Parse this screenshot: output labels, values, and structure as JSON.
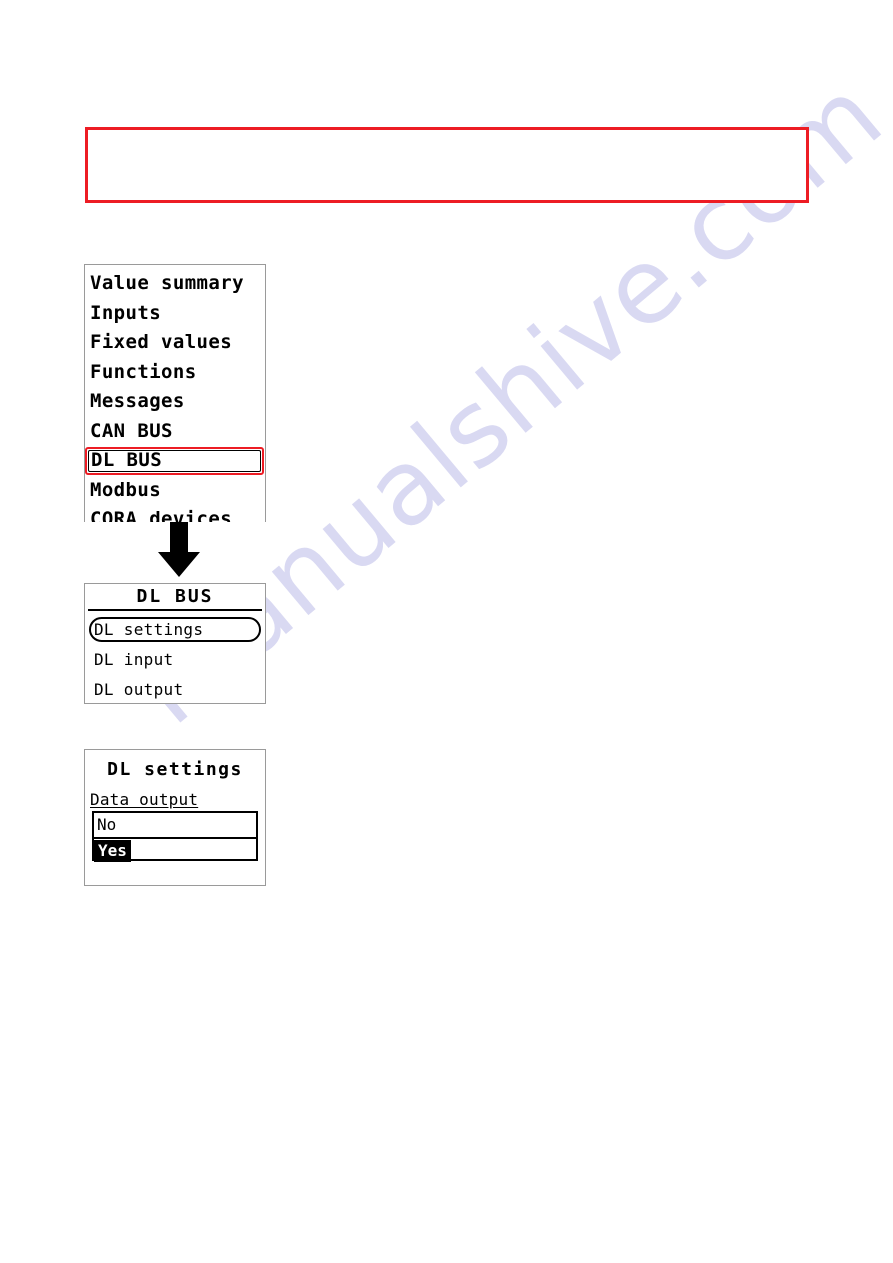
{
  "page": {
    "watermark": "manualshive.com",
    "red_note": ""
  },
  "main_menu": {
    "name": "main-menu",
    "items": [
      {
        "label": "Value summary",
        "selected": false
      },
      {
        "label": "Inputs",
        "selected": false
      },
      {
        "label": "Fixed values",
        "selected": false
      },
      {
        "label": "Functions",
        "selected": false
      },
      {
        "label": "Messages",
        "selected": false
      },
      {
        "label": "CAN BUS",
        "selected": false
      },
      {
        "label": "DL BUS",
        "selected": true
      },
      {
        "label": "Modbus",
        "selected": false
      },
      {
        "label": "CORA devices",
        "selected": false
      }
    ],
    "selection_color": "#ed1c24"
  },
  "arrow": {
    "icon": "arrow-down-icon"
  },
  "dl_bus_menu": {
    "title": "DL BUS",
    "items": [
      {
        "label": "DL settings",
        "selected": true
      },
      {
        "label": "DL input",
        "selected": false
      },
      {
        "label": "DL output",
        "selected": false
      }
    ]
  },
  "dl_settings": {
    "title": "DL settings",
    "field_label": "Data output",
    "options": [
      {
        "label": "No",
        "state": "boxed"
      },
      {
        "label": "Yes",
        "state": "inverted"
      }
    ]
  }
}
